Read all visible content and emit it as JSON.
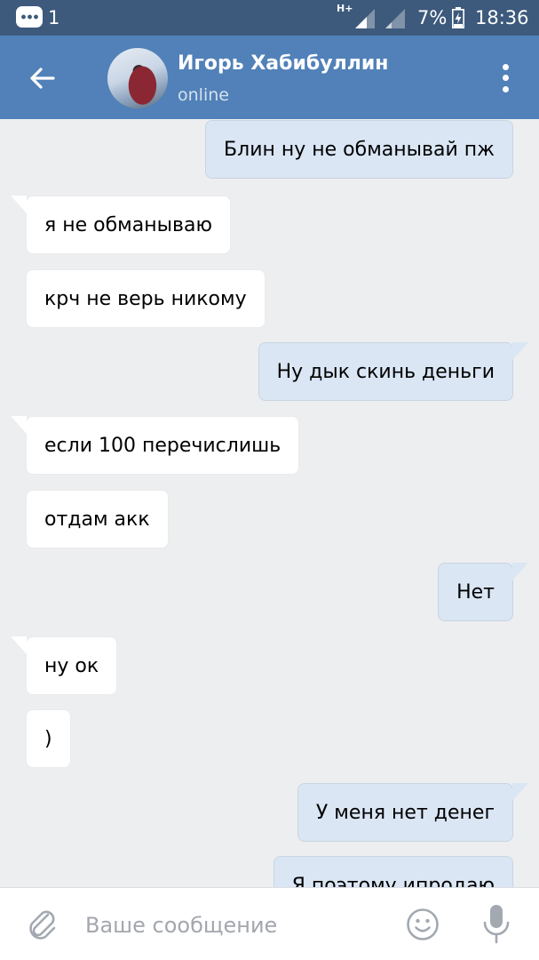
{
  "status_bar": {
    "notification_count": "1",
    "network_type": "H+",
    "battery_percent": "7%",
    "time": "18:36"
  },
  "header": {
    "contact_name": "Игорь Хабибуллин",
    "contact_status": "online"
  },
  "messages": [
    {
      "direction": "out",
      "text": "Блин ну не обманывай пж"
    },
    {
      "direction": "in",
      "text": "я не обманываю"
    },
    {
      "direction": "in",
      "text": "крч не верь никому"
    },
    {
      "direction": "out",
      "text": "Ну дык скинь деньги"
    },
    {
      "direction": "in",
      "text": "если 100 перечислишь"
    },
    {
      "direction": "in",
      "text": "отдам акк"
    },
    {
      "direction": "out",
      "text": "Нет"
    },
    {
      "direction": "in",
      "text": "ну ок"
    },
    {
      "direction": "in",
      "text": ")"
    },
    {
      "direction": "out",
      "text": "У меня нет денег"
    },
    {
      "direction": "out",
      "text": "Я поэтому ипродаю"
    }
  ],
  "composer": {
    "placeholder": "Ваше сообщение"
  },
  "icons": {
    "back": "arrow-left-icon",
    "menu": "more-vertical-icon",
    "attach": "paperclip-icon",
    "emoji": "smile-icon",
    "voice": "microphone-icon"
  },
  "colors": {
    "status_bar": "#3d5a7c",
    "header": "#5181b8",
    "background": "#edeef0",
    "incoming_bubble": "#ffffff",
    "outgoing_bubble": "#dae6f4"
  }
}
